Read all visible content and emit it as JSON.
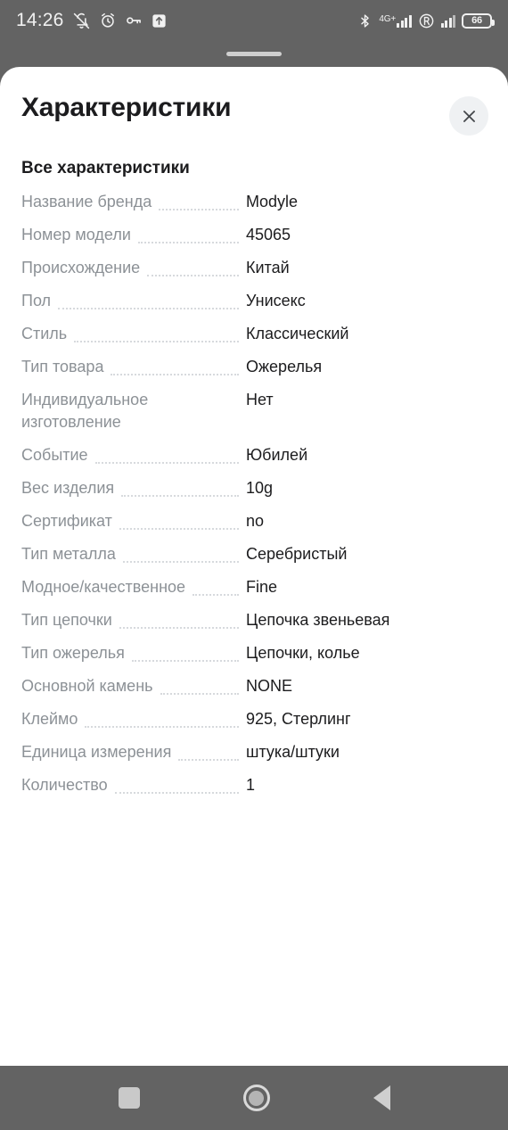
{
  "status_bar": {
    "time": "14:26",
    "battery_percent": "66",
    "network_label": "4G+",
    "icons": [
      "bell-muted-icon",
      "alarm-clock-icon",
      "key-icon",
      "upload-box-icon",
      "bluetooth-icon",
      "signal-icon",
      "roaming-icon",
      "signal-secondary-icon",
      "battery-icon"
    ]
  },
  "sheet": {
    "title": "Характеристики",
    "close_label": "×",
    "section_title": "Все характеристики",
    "specs": [
      {
        "label": "Название бренда",
        "value": "Modyle",
        "wrapped": false
      },
      {
        "label": "Номер модели",
        "value": "45065",
        "wrapped": false
      },
      {
        "label": "Происхождение",
        "value": "Китай",
        "wrapped": false
      },
      {
        "label": "Пол",
        "value": "Унисекс",
        "wrapped": false
      },
      {
        "label": "Стиль",
        "value": "Классический",
        "wrapped": false
      },
      {
        "label": "Тип товара",
        "value": "Ожерелья",
        "wrapped": false
      },
      {
        "label": "Индивидуальное изготовление",
        "value": "Нет",
        "wrapped": true
      },
      {
        "label": "Событие",
        "value": "Юбилей",
        "wrapped": false
      },
      {
        "label": "Вес изделия",
        "value": "10g",
        "wrapped": false
      },
      {
        "label": "Сертификат",
        "value": "no",
        "wrapped": false
      },
      {
        "label": "Тип металла",
        "value": "Серебристый",
        "wrapped": false
      },
      {
        "label": "Модное/качественное",
        "value": "Fine",
        "wrapped": false
      },
      {
        "label": "Тип цепочки",
        "value": "Цепочка звеньевая",
        "wrapped": false
      },
      {
        "label": "Тип ожерелья",
        "value": "Цепочки, колье",
        "wrapped": false
      },
      {
        "label": "Основной камень",
        "value": "NONE",
        "wrapped": false
      },
      {
        "label": "Клеймо",
        "value": "925, Стерлинг",
        "wrapped": false
      },
      {
        "label": "Единица измерения",
        "value": "штука/штуки",
        "wrapped": false
      },
      {
        "label": "Количество",
        "value": "1",
        "wrapped": false
      }
    ]
  },
  "nav_bar": {
    "recents_label": "recents",
    "home_label": "home",
    "back_label": "back"
  },
  "colors": {
    "system_gray": "#636363",
    "sheet_background": "#ffffff",
    "label_gray": "#8c9196",
    "value_dark": "#1c1c1e",
    "dots_gray": "#d7dadd",
    "close_button_bg": "#eff1f3"
  }
}
